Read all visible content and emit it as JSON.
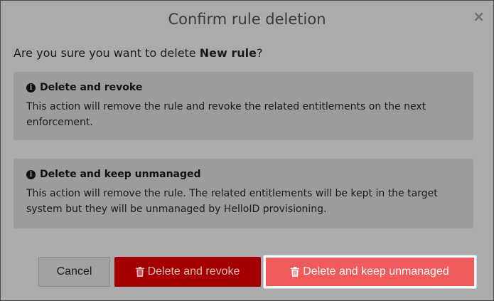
{
  "dialog": {
    "title": "Confirm rule deletion",
    "close_glyph": "×",
    "question_prefix": "Are you sure you want to delete ",
    "rule_name": "New rule",
    "question_suffix": "?"
  },
  "panels": [
    {
      "icon": "info-circle-icon",
      "heading": "Delete and revoke",
      "body": "This action will remove the rule and revoke the related entitlements on the next enforcement."
    },
    {
      "icon": "info-circle-icon",
      "heading": "Delete and keep unmanaged",
      "body": "This action will remove the rule. The related entitlements will be kept in the target system but they will be unmanaged by HelloID provisioning."
    }
  ],
  "buttons": {
    "cancel_label": "Cancel",
    "revoke_label": "Delete and revoke",
    "keep_label": "Delete and keep unmanaged",
    "trash_icon": "trash-icon"
  },
  "colors": {
    "overlay_bg": "#ababab",
    "panel_bg": "#9c9c9c",
    "revoke_button": "#a50000",
    "keep_button": "#f05a5a"
  }
}
